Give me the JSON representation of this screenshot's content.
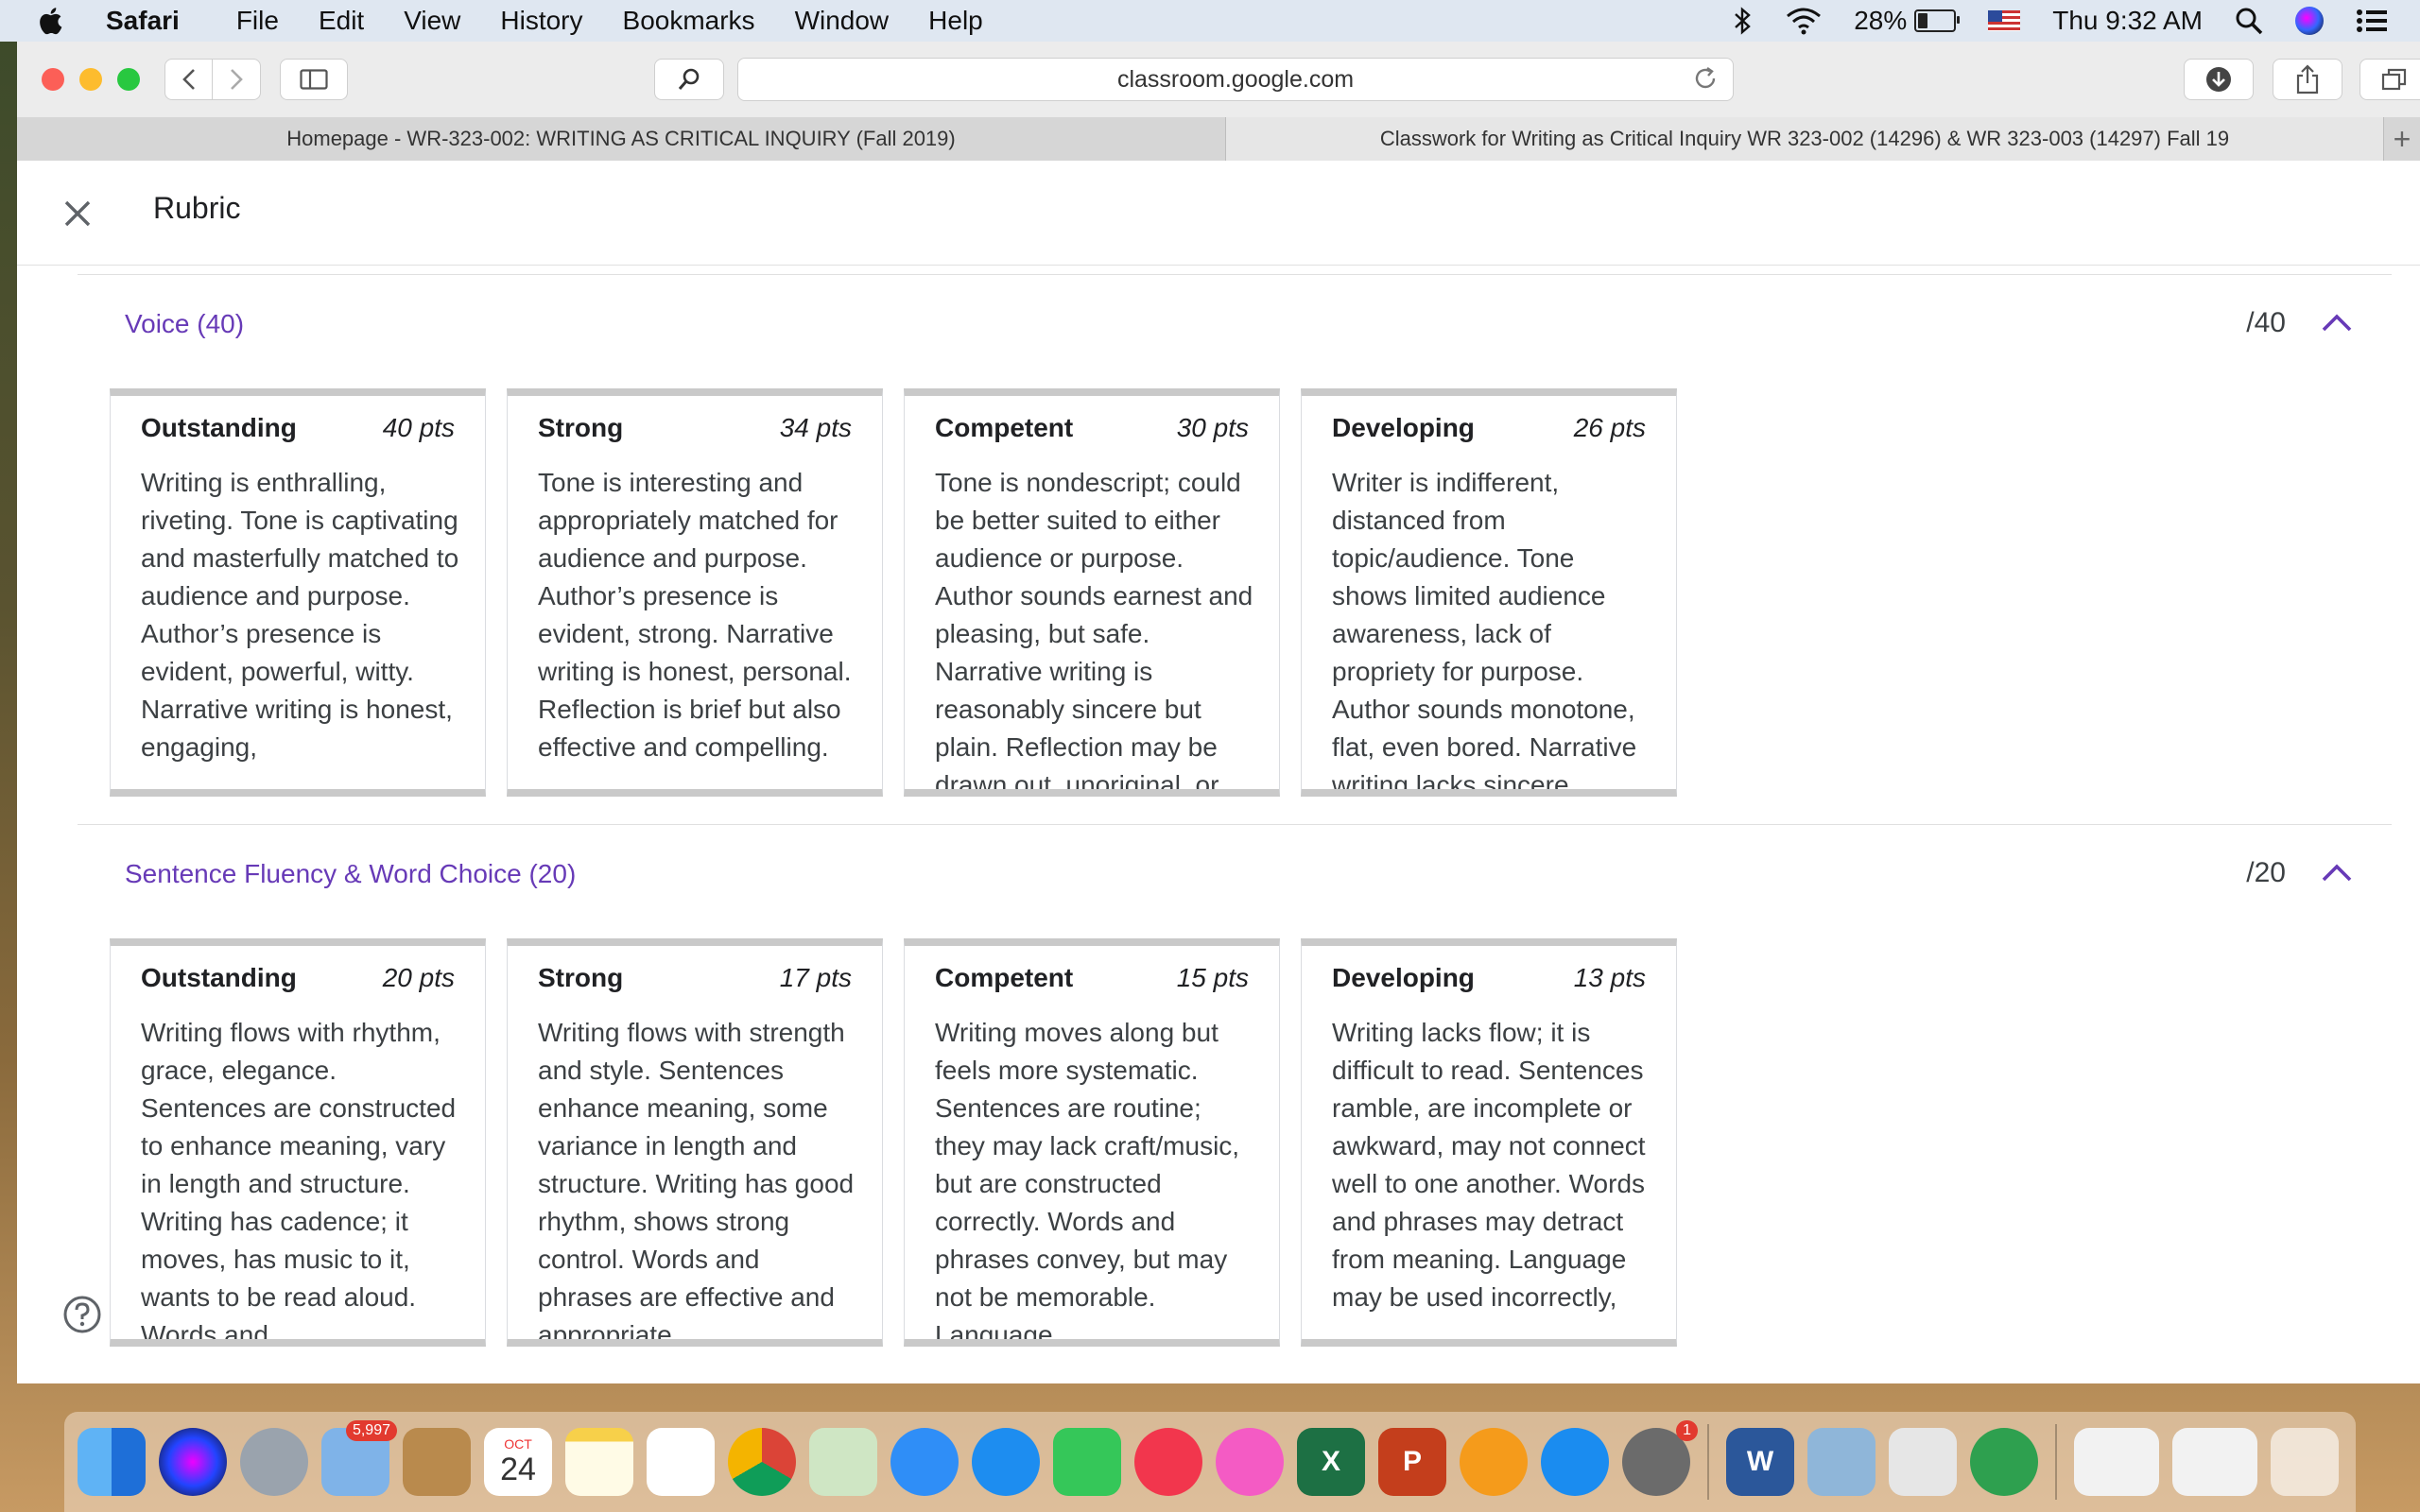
{
  "menubar": {
    "app_name": "Safari",
    "menus": [
      "File",
      "Edit",
      "View",
      "History",
      "Bookmarks",
      "Window",
      "Help"
    ],
    "battery": "28%",
    "battery_level": 0.28,
    "clock": "Thu 9:32 AM"
  },
  "browser": {
    "url": "classroom.google.com",
    "tabs": [
      {
        "title": "Homepage - WR-323-002: WRITING AS CRITICAL INQUIRY (Fall 2019)"
      },
      {
        "title": "Classwork for Writing as Critical Inquiry WR 323-002 (14296) & WR 323-003 (14297) Fall 19"
      }
    ]
  },
  "page": {
    "title": "Rubric",
    "criteria": [
      {
        "title": "Voice (40)",
        "score": "/40",
        "levels": [
          {
            "level": "Outstanding",
            "pts": "40 pts",
            "desc": "Writing is enthralling, riveting. Tone is captivating and masterfully matched to audience and purpose. Author’s presence is evident, powerful, witty. Narrative writing is honest, engaging,"
          },
          {
            "level": "Strong",
            "pts": "34 pts",
            "desc": "Tone is interesting and appropriately matched for audience and purpose. Author’s presence is evident, strong. Narrative writing is honest, personal. Reflection is brief but also effective and compelling."
          },
          {
            "level": "Competent",
            "pts": "30 pts",
            "desc": "Tone is nondescript; could be better suited to either audience or purpose. Author sounds earnest and pleasing, but safe. Narrative writing is reasonably sincere but plain. Reflection may be drawn out, unoriginal, or"
          },
          {
            "level": "Developing",
            "pts": "26 pts",
            "desc": "Writer is indifferent, distanced from topic/audience. Tone shows limited audience awareness, lack of propriety for purpose. Author sounds monotone, flat, even bored. Narrative writing lacks sincere"
          }
        ]
      },
      {
        "title": "Sentence Fluency & Word Choice (20)",
        "score": "/20",
        "levels": [
          {
            "level": "Outstanding",
            "pts": "20 pts",
            "desc": "Writing flows with rhythm, grace, elegance. Sentences are constructed to enhance meaning, vary in length and structure. Writing has cadence; it moves, has music to it, wants to be read aloud. Words and"
          },
          {
            "level": "Strong",
            "pts": "17 pts",
            "desc": "Writing flows with strength and style. Sentences enhance meaning, some variance in length and structure. Writing has good rhythm, shows strong control. Words and phrases are effective and appropriate."
          },
          {
            "level": "Competent",
            "pts": "15 pts",
            "desc": "Writing moves along but feels more systematic. Sentences are routine; they may lack craft/music, but are constructed correctly. Words and phrases convey, but may not be memorable. Language"
          },
          {
            "level": "Developing",
            "pts": "13 pts",
            "desc": "Writing lacks flow; it is difficult to read. Sentences ramble, are incomplete or awkward, may not connect well to one another. Words and phrases may detract from meaning. Language may be used incorrectly,"
          }
        ]
      }
    ]
  },
  "dock": {
    "mail_badge": "5,997",
    "calendar_month": "OCT",
    "calendar_day": "24",
    "prefs_badge": "1",
    "icons": [
      "finder-icon",
      "siri-icon",
      "launchpad-icon",
      "mail-icon",
      "contacts-icon",
      "calendar-icon",
      "notes-icon",
      "reminders-icon",
      "chrome-icon",
      "maps-icon",
      "messages-icon",
      "safari-icon",
      "facetime-icon",
      "news-icon",
      "music-icon",
      "excel-icon",
      "powerpoint-icon",
      "books-icon",
      "app-store-icon",
      "system-preferences-icon",
      "word-icon",
      "preview-icon",
      "installer-icon",
      "search-app-icon",
      "documents-icon",
      "trash-icon"
    ]
  },
  "colors": {
    "accent": "#673ab7",
    "menubar": "#dfe7f1"
  }
}
